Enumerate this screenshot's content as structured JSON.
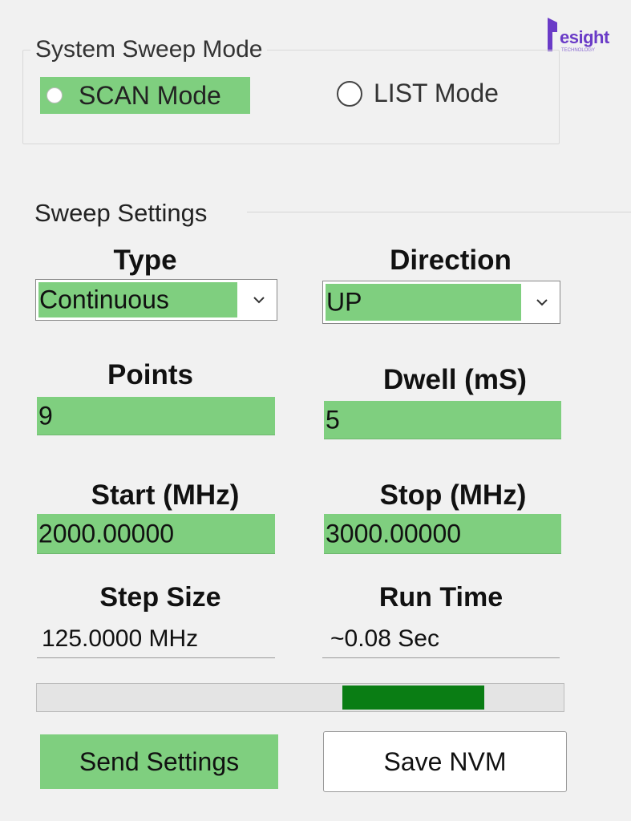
{
  "logo": {
    "text": "esight",
    "subtext": "TECHNOLOGY"
  },
  "sweep_mode": {
    "title": "System Sweep Mode",
    "scan_label": "SCAN Mode",
    "list_label": "LIST Mode",
    "selected": "SCAN Mode"
  },
  "sweep_settings": {
    "title": "Sweep Settings",
    "type": {
      "label": "Type",
      "value": "Continuous"
    },
    "direction": {
      "label": "Direction",
      "value": "UP"
    },
    "points": {
      "label": "Points",
      "value": "9"
    },
    "dwell": {
      "label": "Dwell (mS)",
      "value": "5"
    },
    "start": {
      "label": "Start (MHz)",
      "value": "2000.00000"
    },
    "stop": {
      "label": "Stop (MHz)",
      "value": "3000.00000"
    },
    "step_size": {
      "label": "Step Size",
      "value": "125.0000 MHz"
    },
    "run_time": {
      "label": "Run Time",
      "value": "~0.08 Sec"
    }
  },
  "progress": {
    "start_fraction": 0.58,
    "end_fraction": 0.85,
    "color": "#0a7d14"
  },
  "buttons": {
    "send": "Send Settings",
    "save": "Save NVM"
  },
  "colors": {
    "accent": "#7fcf7f",
    "background": "#f1f1f1"
  }
}
